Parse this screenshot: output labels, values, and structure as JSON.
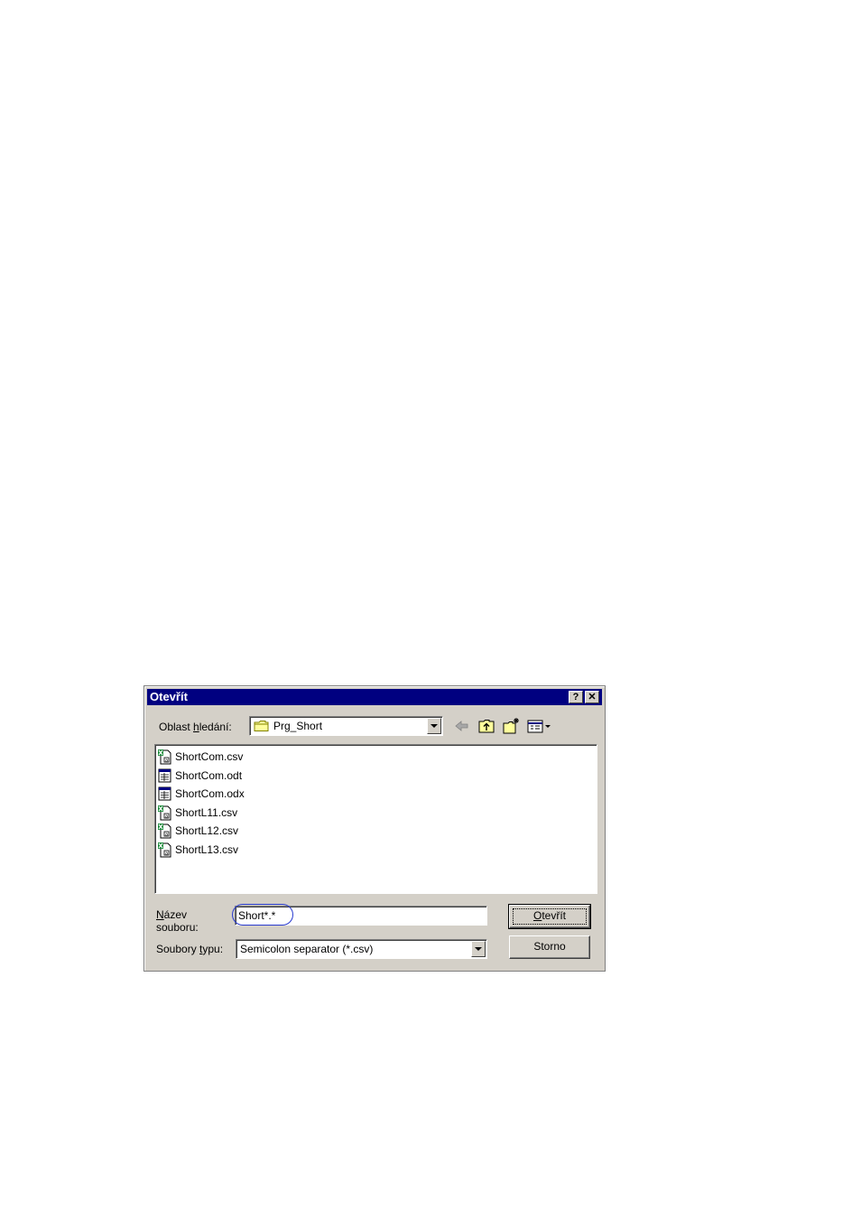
{
  "dialog": {
    "title": "Otevřít",
    "help_glyph": "?",
    "close_glyph": "✕"
  },
  "toolbar": {
    "lookin_label_pre": "Oblast ",
    "lookin_label_u": "h",
    "lookin_label_post": "ledání:",
    "lookin_value": "Prg_Short",
    "icons": [
      "back-arrow-icon",
      "up-folder-icon",
      "new-folder-icon",
      "view-menu-icon"
    ]
  },
  "files": [
    {
      "name": "ShortCom.csv",
      "icon": "csv-file-icon"
    },
    {
      "name": "ShortCom.odt",
      "icon": "odt-file-icon"
    },
    {
      "name": "ShortCom.odx",
      "icon": "odx-file-icon"
    },
    {
      "name": "ShortL11.csv",
      "icon": "csv-file-icon"
    },
    {
      "name": "ShortL12.csv",
      "icon": "csv-file-icon"
    },
    {
      "name": "ShortL13.csv",
      "icon": "csv-file-icon"
    }
  ],
  "filename": {
    "label_line1_u": "N",
    "label_line1_rest": "ázev",
    "label_line2": "souboru:",
    "value": "Short*.*"
  },
  "filetype": {
    "label_pre": "Soubory ",
    "label_u": "t",
    "label_post": "ypu:",
    "value": "Semicolon separator (*.csv)"
  },
  "buttons": {
    "open_u": "O",
    "open_rest": "tevřít",
    "cancel": "Storno"
  },
  "colors": {
    "title_bar": "#000080",
    "dialog_face": "#d4d0c8",
    "highlight_ellipse": "#2a3cd0"
  }
}
